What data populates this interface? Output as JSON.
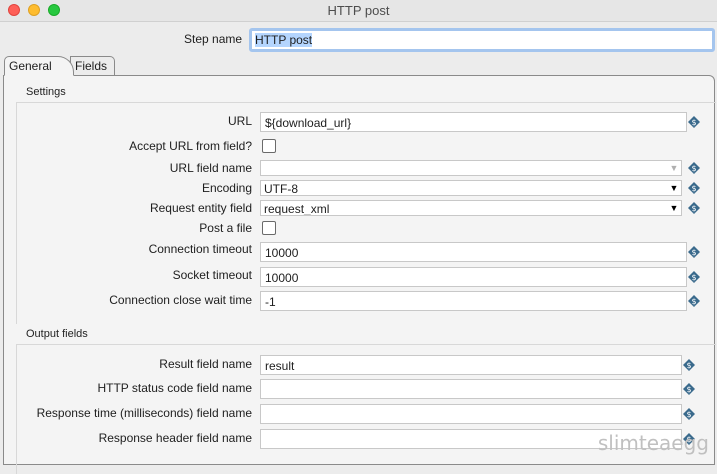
{
  "window": {
    "title": "HTTP post"
  },
  "step": {
    "label": "Step name",
    "value": "HTTP post"
  },
  "tabs": [
    {
      "label": "General"
    },
    {
      "label": "Fields"
    }
  ],
  "settings": {
    "title": "Settings",
    "url": {
      "label": "URL",
      "value": "${download_url}"
    },
    "accept_url": {
      "label": "Accept URL from field?",
      "checked": false
    },
    "url_field_name": {
      "label": "URL field name",
      "value": ""
    },
    "encoding": {
      "label": "Encoding",
      "value": "UTF-8"
    },
    "request_entity": {
      "label": "Request entity field",
      "value": "request_xml"
    },
    "post_file": {
      "label": "Post a file",
      "checked": false
    },
    "connection_timeout": {
      "label": "Connection timeout",
      "value": "10000"
    },
    "socket_timeout": {
      "label": "Socket timeout",
      "value": "10000"
    },
    "close_wait": {
      "label": "Connection close wait time",
      "value": "-1"
    }
  },
  "output": {
    "title": "Output fields",
    "result": {
      "label": "Result field name",
      "value": "result"
    },
    "http_status": {
      "label": "HTTP status code field name",
      "value": ""
    },
    "response_time": {
      "label": "Response time (milliseconds) field name",
      "value": ""
    },
    "response_header": {
      "label": "Response header field name",
      "value": ""
    }
  },
  "watermark": "slimteaegg",
  "colors": {
    "accent": "#a4c5ee",
    "var_icon": "#3a6a8c"
  }
}
